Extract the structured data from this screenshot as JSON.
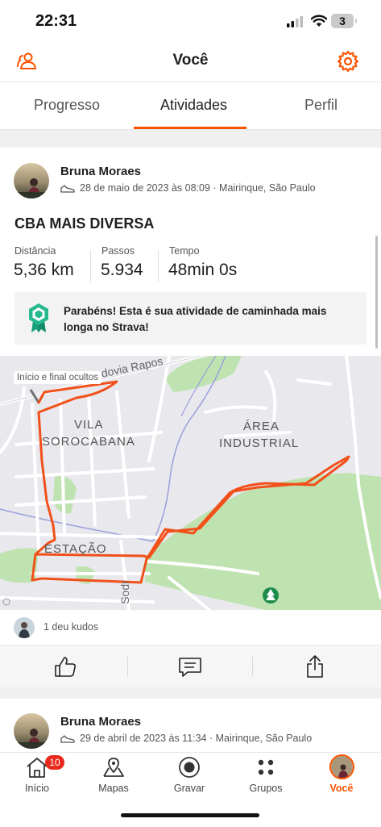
{
  "status_bar": {
    "time": "22:31",
    "battery": "3"
  },
  "header": {
    "title": "Você"
  },
  "tabs": [
    {
      "label": "Progresso"
    },
    {
      "label": "Atividades"
    },
    {
      "label": "Perfil"
    }
  ],
  "activity": {
    "athlete": "Bruna Moraes",
    "meta": "28 de maio de 2023 às 08:09 · Mairinque, São Paulo",
    "title": "CBA MAIS DIVERSA",
    "stats": [
      {
        "label": "Distância",
        "value": "5,36 km"
      },
      {
        "label": "Passos",
        "value": "5.934"
      },
      {
        "label": "Tempo",
        "value": "48min 0s"
      }
    ],
    "achievement": "Parabéns! Esta é sua atividade de caminhada mais longa no Strava!",
    "map": {
      "hidden_label": "Início e final ocultos",
      "labels": {
        "road": "dovia Rapos",
        "vila_1": "VILA",
        "vila_2": "SOROCABANA",
        "area_1": "ÁREA",
        "area_2": "INDUSTRIAL",
        "estacao": "ESTAÇÃO",
        "sodr": "Sodr"
      }
    },
    "kudos": "1 deu kudos"
  },
  "next_activity": {
    "athlete": "Bruna Moraes",
    "meta": "29 de abril de 2023 às 11:34 · Mairinque, São Paulo"
  },
  "nav": {
    "badge": "10",
    "items": [
      {
        "label": "Início"
      },
      {
        "label": "Mapas"
      },
      {
        "label": "Gravar"
      },
      {
        "label": "Grupos"
      },
      {
        "label": "Você"
      }
    ]
  },
  "colors": {
    "accent": "#fc5200",
    "route": "#f2501a",
    "park": "#bfe3b0",
    "badge": "#e8291c"
  }
}
